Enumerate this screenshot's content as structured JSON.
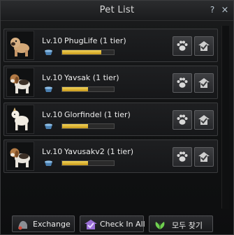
{
  "window": {
    "title": "Pet List",
    "help_label": "?",
    "close_label": "×"
  },
  "pets": [
    {
      "level": "Lv.10",
      "name": "PhugLife (1 tier)",
      "exp_fraction": 0.75,
      "portrait": "pug-portrait"
    },
    {
      "level": "Lv.10",
      "name": "Yavsak (1 tier)",
      "exp_fraction": 0.5,
      "portrait": "beagle-portrait"
    },
    {
      "level": "Lv.10",
      "name": "Glorfindel (1 tier)",
      "exp_fraction": 0.5,
      "portrait": "white-dog-portrait"
    },
    {
      "level": "Lv.10",
      "name": "Yavusakv2 (1 tier)",
      "exp_fraction": 0.5,
      "portrait": "beagle-portrait"
    }
  ],
  "actions": {
    "paw_icon": "paw-icon",
    "checkin_icon": "check-in-icon"
  },
  "footer": {
    "exchange_label": "Exchange",
    "checkin_all_label": "Check In All",
    "find_all_label": "모두 찾기"
  },
  "colors": {
    "exp_bar": "#e6c03a",
    "accent_green": "#6fcf4f",
    "accent_purple": "#9a6fd6"
  }
}
